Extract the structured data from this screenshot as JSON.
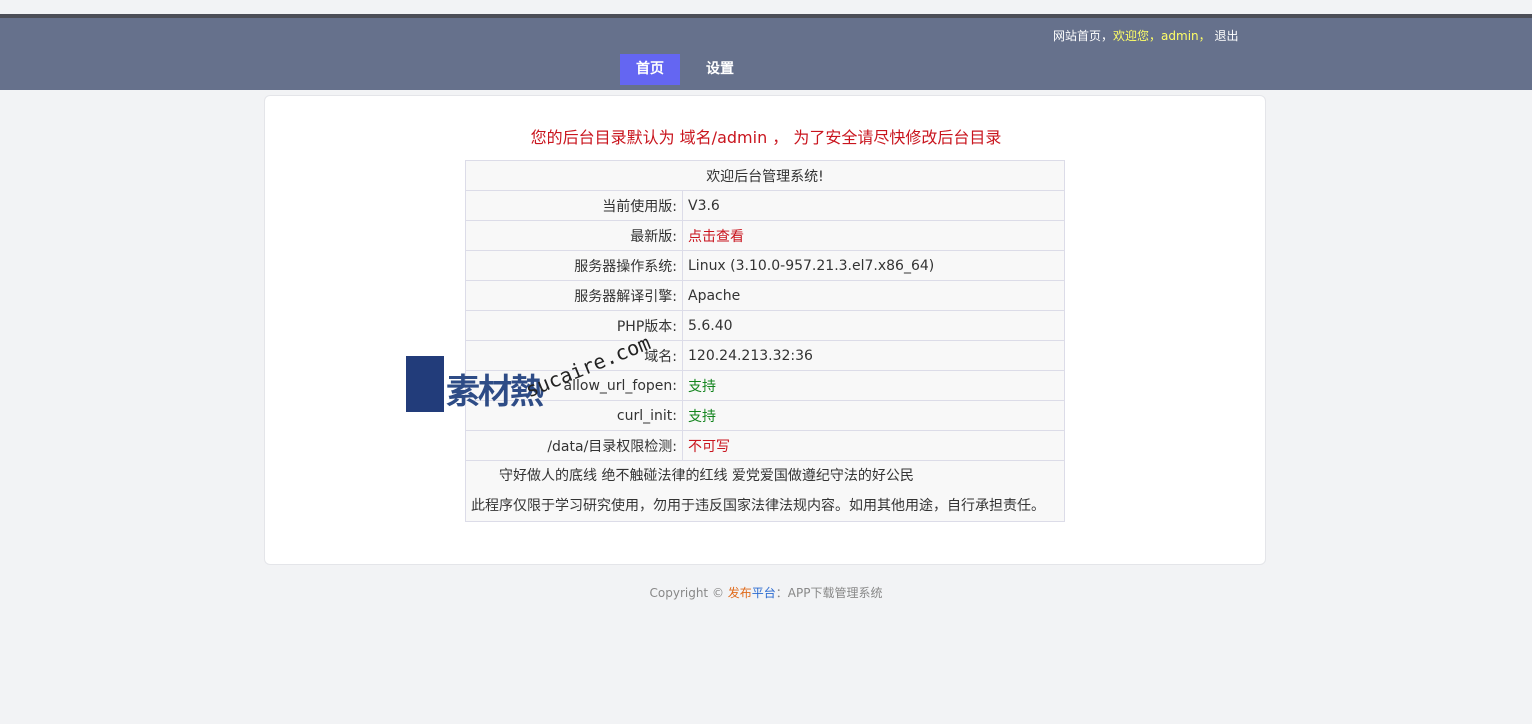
{
  "header": {
    "site_home": "网站首页",
    "sep1": "，",
    "welcome": "欢迎您，admin，",
    "logout": "退出",
    "nav": [
      {
        "label": "首页",
        "active": true
      },
      {
        "label": "设置",
        "active": false
      }
    ]
  },
  "notice": "您的后台目录默认为 域名/admin ， 为了安全请尽快修改后台目录",
  "info_table": {
    "title": "欢迎后台管理系统!",
    "rows": [
      {
        "key": "当前使用版:",
        "value": "V3.6",
        "status": "normal"
      },
      {
        "key": "最新版:",
        "value": "点击查看",
        "status": "link"
      },
      {
        "key": "服务器操作系统:",
        "value": "Linux (3.10.0-957.21.3.el7.x86_64)",
        "status": "normal"
      },
      {
        "key": "服务器解译引擎:",
        "value": "Apache",
        "status": "normal"
      },
      {
        "key": "PHP版本:",
        "value": "5.6.40",
        "status": "normal"
      },
      {
        "key": "域名:",
        "value": "120.24.213.32:36",
        "status": "normal"
      },
      {
        "key": "allow_url_fopen:",
        "value": "支持",
        "status": "ok"
      },
      {
        "key": "curl_init:",
        "value": "支持",
        "status": "ok"
      },
      {
        "key": "/data/目录权限检测:",
        "value": "不可写",
        "status": "bad"
      }
    ],
    "footer_line1": "守好做人的底线 绝不触碰法律的红线 爱党爱国做遵纪守法的好公民",
    "footer_line2": "此程序仅限于学习研究使用，勿用于违反国家法律法规内容。如用其他用途，自行承担责任。"
  },
  "watermark": {
    "brand": "素材熱",
    "url": "sucaire.com"
  },
  "copyright": {
    "prefix": "Copyright © ",
    "part1": "发布",
    "part2": "平台",
    "suffix": "：APP下载管理系统"
  },
  "colors": {
    "header_bg": "#66718c",
    "nav_active": "#6466f2",
    "alert_red": "#c9151e",
    "ok_green": "#13851e"
  }
}
